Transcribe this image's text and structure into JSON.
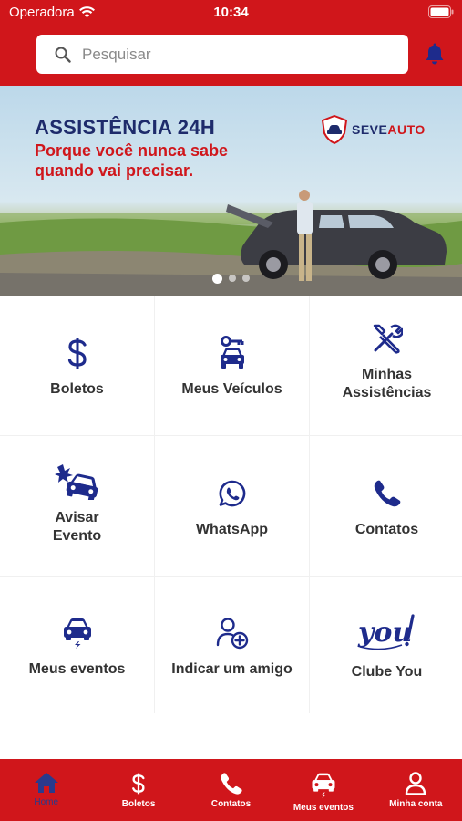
{
  "status_bar": {
    "carrier": "Operadora",
    "time": "10:34"
  },
  "search": {
    "placeholder": "Pesquisar"
  },
  "banner": {
    "title": "ASSISTÊNCIA 24H",
    "subtitle": "Porque você nunca sabe quando vai precisar.",
    "brand_a": "SEVE",
    "brand_b": "AUTO",
    "slides": 3,
    "active_slide": 1
  },
  "menu": [
    {
      "label": "Boletos",
      "icon": "dollar-icon"
    },
    {
      "label": "Meus Veículos",
      "icon": "car-key-icon"
    },
    {
      "label": "Minhas\nAssistências",
      "icon": "tools-icon"
    },
    {
      "label": "Avisar\nEvento",
      "icon": "car-crash-icon"
    },
    {
      "label": "WhatsApp",
      "icon": "whatsapp-icon"
    },
    {
      "label": "Contatos",
      "icon": "phone-icon"
    },
    {
      "label": "Meus eventos",
      "icon": "car-event-icon"
    },
    {
      "label": "Indicar um amigo",
      "icon": "add-user-icon"
    },
    {
      "label": "Clube You",
      "icon": "clube-you-logo"
    }
  ],
  "tabbar": {
    "home": "Home",
    "boletos": "Boletos",
    "contatos": "Contatos",
    "eventos": "Meus eventos",
    "conta": "Minha conta"
  },
  "colors": {
    "brand_red": "#d0161b",
    "brand_blue": "#1e2b8c",
    "tab_active": "#2a3a8c"
  }
}
